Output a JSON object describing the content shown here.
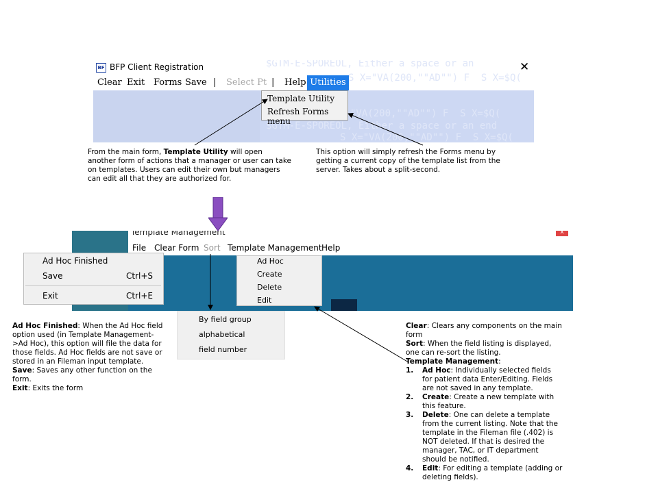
{
  "top_window": {
    "title": "BFP Client Registration",
    "icon_text": "BF",
    "close_glyph": "✕",
    "menu": {
      "clear": "Clear",
      "exit": "Exit",
      "forms": "Forms",
      "save": "Save",
      "sep1": "|",
      "select_pt": "Select Pt",
      "sep2": "|",
      "help": "Help",
      "utilities": "Utilities"
    },
    "utilities_menu": {
      "template_utility": "Template Utility",
      "refresh_forms": "Refresh Forms menu"
    },
    "background_code": [
      "$GTM-E-SPOREOL, Either a space or an",
      "S X=\"VA(200,\"\"AD\"\") F  S X=$Q(",
      "\"VA(200,\"\"AD\"\") F  S X=$Q(",
      "$GTM-E-SPOREOL, Either a space or an end",
      "S X=\"VA(200,\"\"AD\"\") F  S X=$Q("
    ]
  },
  "notes": {
    "template_utility": {
      "prefix": "From the main form, ",
      "bold": "Template Utility",
      "lines": [
        " will open",
        "another form of actions that a manager or user can take",
        "on templates. Users can edit their own but managers",
        "can edit all that they are authorized for."
      ]
    },
    "refresh": [
      "This option will simply refresh the Forms menu by",
      "getting a current copy of the template list from the",
      "server. Takes about a split-second."
    ]
  },
  "bottom_window": {
    "title": "Template Management",
    "close_glyph": "x",
    "menu": {
      "file": "File",
      "clear_form": "Clear Form",
      "sort": "Sort",
      "template_management": "Template Management",
      "help": "Help"
    },
    "file_menu": {
      "ad_hoc_finished": "Ad Hoc Finished",
      "save": "Save",
      "save_shortcut": "Ctrl+S",
      "exit": "Exit",
      "exit_shortcut": "Ctrl+E"
    },
    "template_menu": {
      "ad_hoc": "Ad Hoc",
      "create": "Create",
      "delete": "Delete",
      "edit": "Edit"
    },
    "sort_menu": {
      "by_field_group": "By field group",
      "alphabetical": "alphabetical",
      "field_number": "field number"
    }
  },
  "left_notes": {
    "ad_hoc_label": "Ad Hoc Finished",
    "ad_hoc_lines": [
      ": When the Ad Hoc field",
      "option used (in Template Management-",
      ">Ad Hoc), this option will file the data for",
      "those fields. Ad Hoc fields are not save or",
      "stored in an Fileman input template."
    ],
    "save_label": "Save",
    "save_lines": [
      ": Saves any other function on the",
      "form."
    ],
    "exit_label": "Exit",
    "exit_text": ": Exits the form"
  },
  "right_notes": {
    "clear_label": "Clear",
    "clear_lines": [
      ": Clears any components on the main",
      "form"
    ],
    "sort_label": "Sort",
    "sort_lines": [
      ": When the field listing is displayed,",
      "one can re-sort the listing."
    ],
    "tm_label": "Template Management",
    "tm_colon": ":",
    "items": [
      {
        "num": "1.",
        "label": "Ad Hoc",
        "lines": [
          ": Individually selected fields",
          "for patient data Enter/Editing. Fields",
          "are not saved in any template."
        ]
      },
      {
        "num": "2.",
        "label": "Create",
        "lines": [
          ": Create a new template with",
          "this feature."
        ]
      },
      {
        "num": "3.",
        "label": "Delete",
        "lines": [
          ": One can delete a template",
          "from the current listing. Note that the",
          "template in the Fileman file (.402) is",
          "NOT deleted. If that is desired the",
          "manager, TAC,  or IT department",
          "should be notified."
        ]
      },
      {
        "num": "4.",
        "label": "Edit",
        "lines": [
          ": For editing a template (adding or",
          "deleting fields)."
        ]
      }
    ]
  },
  "colors": {
    "utilities_highlight": "#1e7ce8",
    "top_body": "#c9d4ef",
    "bottom_body": "#1b6e98",
    "purple_arrow": "#8a4ec0",
    "menu_bg": "#f0f0f0"
  }
}
